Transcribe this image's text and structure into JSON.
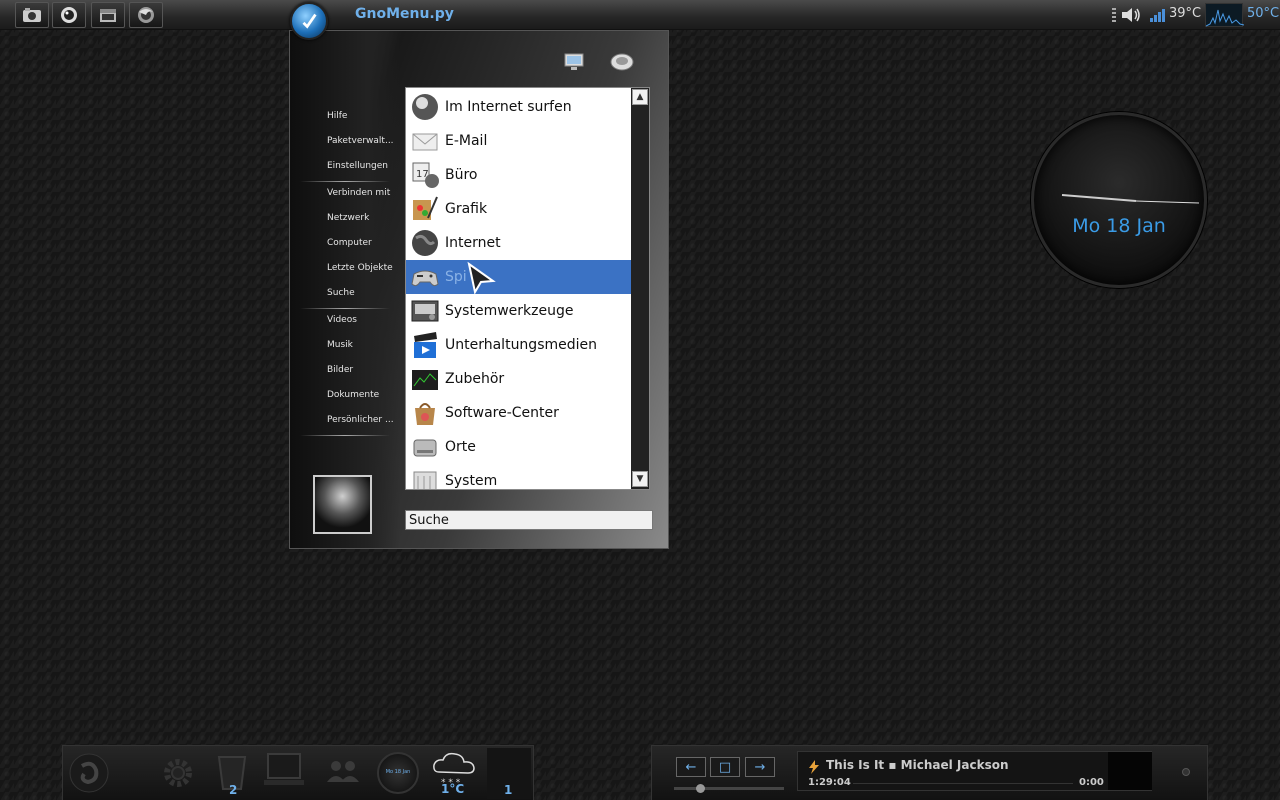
{
  "top_panel": {
    "menu_title": "GnoMenu.py",
    "launchers": [
      "camera-icon",
      "astronaut-icon",
      "window-icon",
      "firefox-icon"
    ],
    "cpu_temp": "39°C",
    "gpu_temp": "50°C"
  },
  "menu": {
    "sidebar": {
      "group1": [
        "Hilfe",
        "Paketverwalt...",
        "Einstellungen"
      ],
      "group2": [
        "Verbinden mit",
        "Netzwerk",
        "Computer",
        "Letzte Objekte",
        "Suche"
      ],
      "group3": [
        "Videos",
        "Musik",
        "Bilder",
        "Dokumente",
        "Persönlicher ..."
      ]
    },
    "items": [
      {
        "label": "Im Internet surfen",
        "icon": "globe-icon"
      },
      {
        "label": "E-Mail",
        "icon": "envelope-icon"
      },
      {
        "label": "Büro",
        "icon": "office-icon"
      },
      {
        "label": "Grafik",
        "icon": "graphics-icon"
      },
      {
        "label": "Internet",
        "icon": "earth-icon"
      },
      {
        "label": "Spi",
        "icon": "gamepad-icon",
        "selected": true
      },
      {
        "label": "Systemwerkzeuge",
        "icon": "system-tools-icon"
      },
      {
        "label": "Unterhaltungsmedien",
        "icon": "clapperboard-icon"
      },
      {
        "label": "Zubehör",
        "icon": "accessories-icon"
      },
      {
        "label": "Software-Center",
        "icon": "software-center-icon"
      },
      {
        "label": "Orte",
        "icon": "drive-icon"
      },
      {
        "label": "System",
        "icon": "system-icon"
      }
    ],
    "search_value": "Suche"
  },
  "clock": {
    "date": "Mo 18 Jan"
  },
  "dock": {
    "trash_count": "2",
    "weather_temp": "1°C",
    "workspace": "1",
    "clock_mini": "Mo 18 Jan"
  },
  "player": {
    "track": "This Is It",
    "artist": "Michael Jackson",
    "elapsed": "1:29:04",
    "remaining": "0:00"
  },
  "colors": {
    "accent": "#3a9be6",
    "selection": "#3b72c4",
    "panel": "#262626"
  }
}
